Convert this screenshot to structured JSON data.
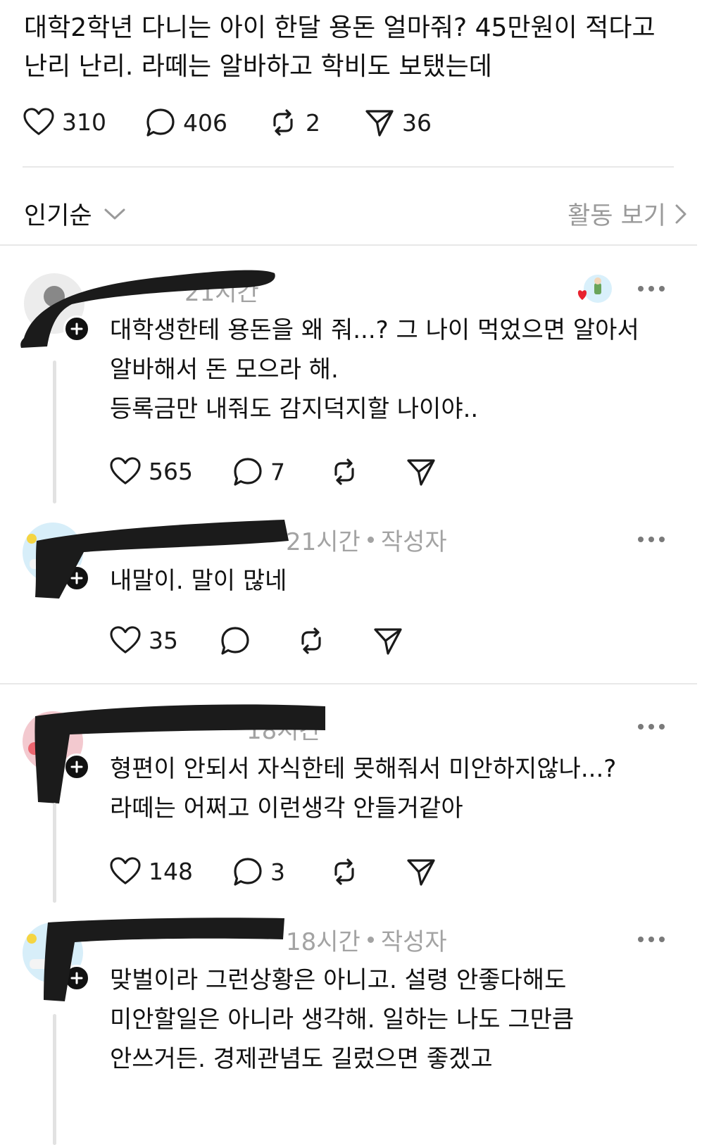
{
  "post": {
    "lines": [
      "대학2학년 다니는 아이 한달 용돈 얼마줘? 45만원이 적다고",
      "난리 난리. 라떼는 알바하고 학비도 보탰는데"
    ],
    "likes": "310",
    "replies": "406",
    "reposts": "2",
    "shares": "36"
  },
  "sort": {
    "label": "인기순",
    "activity_label": "활동 보기"
  },
  "comments": [
    {
      "meta": "21시간",
      "lines": [
        "대학생한테 용돈을 왜 줘...? 그 나이 먹었으면 알아서",
        "알바해서 돈 모으라 해.",
        "등록금만 내줘도 감지덕지할 나이야.."
      ],
      "likes": "565",
      "replies": "7"
    },
    {
      "meta": "21시간",
      "author_tag": "작성자",
      "lines": [
        "내말이. 말이 많네"
      ],
      "likes": "35"
    },
    {
      "meta": "18시간",
      "lines": [
        "형편이 안되서 자식한테 못해줘서 미안하지않나...?",
        "라떼는 어쩌고 이런생각 안들거같아"
      ],
      "likes": "148",
      "replies": "3"
    },
    {
      "meta": "18시간",
      "author_tag": "작성자",
      "lines": [
        "맞벌이라 그런상황은 아니고. 설령 안좋다해도",
        "미안할일은 아니라 생각해. 일하는 나도 그만큼",
        "안쓰거든. 경제관념도 길렀으면 좋겠고"
      ]
    }
  ],
  "colors": {
    "text": "#111111",
    "muted": "#a3a3a3",
    "divider": "#e8e8e8",
    "heart_accent": "#e8232f"
  },
  "icons": {
    "like": "heart-outline-icon",
    "reply": "speech-bubble-icon",
    "repost": "repost-arrows-icon",
    "share": "paper-plane-icon",
    "more": "ellipsis-icon",
    "follow": "plus-icon",
    "sort": "chevron-down-icon",
    "activity": "chevron-right-icon"
  }
}
